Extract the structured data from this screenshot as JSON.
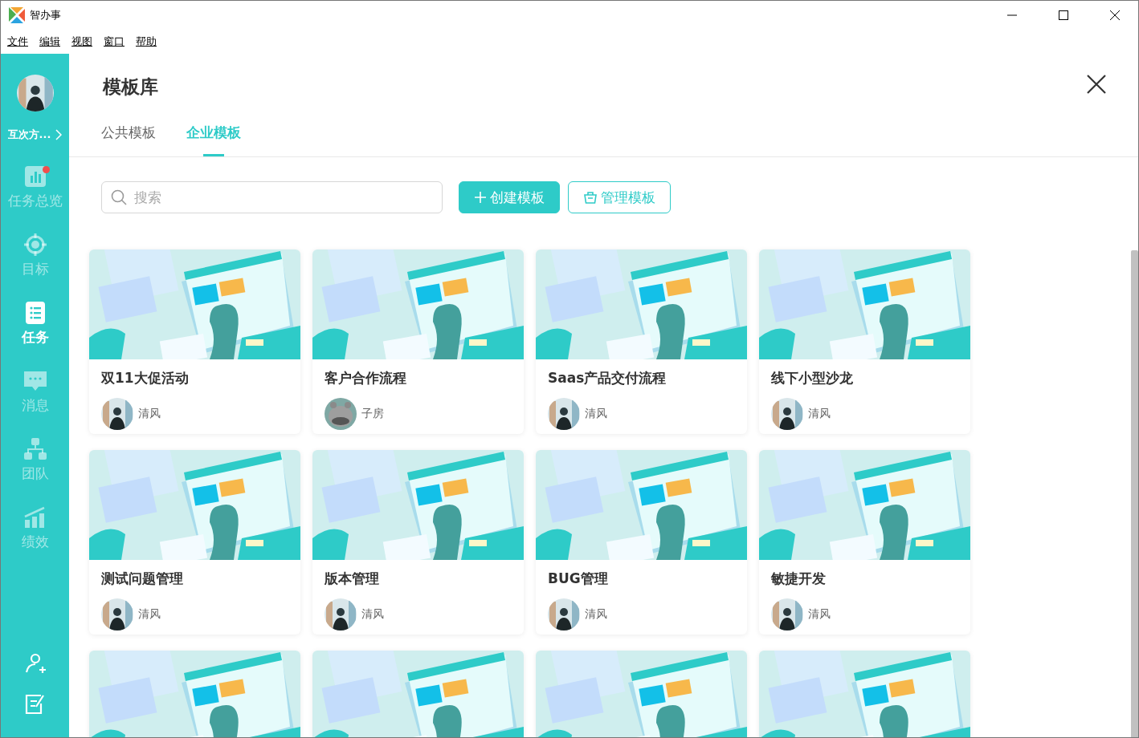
{
  "window": {
    "title": "智办事"
  },
  "menu": [
    "文件",
    "编辑",
    "视图",
    "窗口",
    "帮助"
  ],
  "sidebar": {
    "user": "互次方...",
    "items": [
      {
        "label": "任务总览",
        "selected": false,
        "alert": true
      },
      {
        "label": "目标",
        "selected": false,
        "alert": false
      },
      {
        "label": "任务",
        "selected": true,
        "alert": false
      },
      {
        "label": "消息",
        "selected": false,
        "alert": false
      },
      {
        "label": "团队",
        "selected": false,
        "alert": false
      },
      {
        "label": "绩效",
        "selected": false,
        "alert": false
      }
    ]
  },
  "page": {
    "title": "模板库",
    "tabs": [
      {
        "label": "公共模板",
        "selected": false
      },
      {
        "label": "企业模板",
        "selected": true
      }
    ],
    "search": {
      "placeholder": "搜索"
    },
    "buttons": [
      {
        "label": "创建模板",
        "kind": "primary"
      },
      {
        "label": "管理模板",
        "kind": "outline"
      }
    ]
  },
  "cards": [
    {
      "kind": "full",
      "title": "双11大促活动",
      "author": "清风"
    },
    {
      "kind": "full",
      "title": "客户合作流程",
      "author": "子房",
      "avatar": {
        "kind": "hippo"
      }
    },
    {
      "kind": "full",
      "title": "Saas产品交付流程",
      "author": "清风"
    },
    {
      "kind": "full",
      "title": "线下小型沙龙",
      "author": "清风"
    },
    {
      "kind": "full",
      "title": "测试问题管理",
      "author": "清风"
    },
    {
      "kind": "full",
      "title": "版本管理",
      "author": "清风"
    },
    {
      "kind": "full",
      "title": "BUG管理",
      "author": "清风"
    },
    {
      "kind": "full",
      "title": "敏捷开发",
      "author": "清风"
    },
    {
      "kind": "cut"
    },
    {
      "kind": "cut"
    },
    {
      "kind": "cut"
    },
    {
      "kind": "cut"
    }
  ]
}
